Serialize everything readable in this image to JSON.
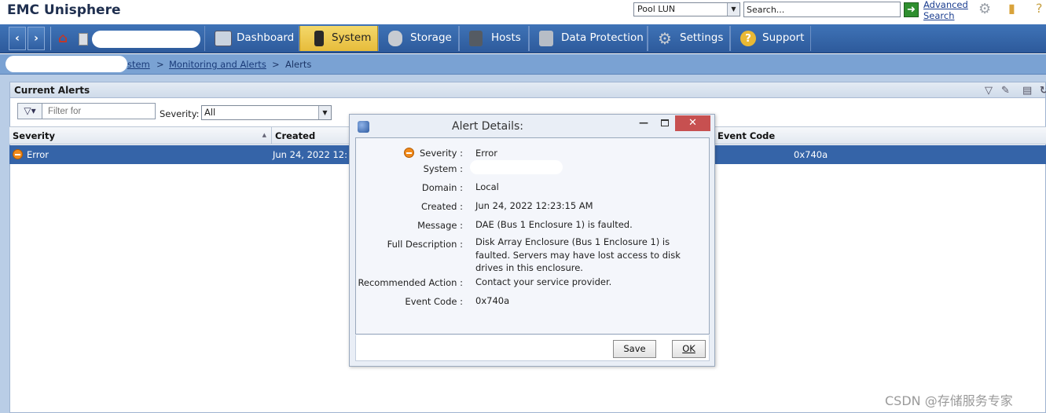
{
  "header": {
    "app_title": "EMC Unisphere",
    "scope_selected": "Pool LUN",
    "search_value": "Search...",
    "advanced_search_line1": "Advanced",
    "advanced_search_line2": "Search"
  },
  "nav": {
    "tabs": [
      {
        "label": "Dashboard",
        "icon": "dashboard-icon",
        "active": false
      },
      {
        "label": "System",
        "icon": "system-icon",
        "active": true
      },
      {
        "label": "Storage",
        "icon": "storage-icon",
        "active": false
      },
      {
        "label": "Hosts",
        "icon": "hosts-icon",
        "active": false
      },
      {
        "label": "Data Protection",
        "icon": "data-protection-icon",
        "active": false
      },
      {
        "label": "Settings",
        "icon": "settings-icon",
        "active": false
      },
      {
        "label": "Support",
        "icon": "support-icon",
        "active": false
      }
    ]
  },
  "breadcrumb": {
    "part_system": "stem",
    "sep": ">",
    "monitoring": "Monitoring and Alerts",
    "current": "Alerts"
  },
  "panel": {
    "title": "Current Alerts",
    "filter_placeholder": "Filter for",
    "severity_label": "Severity:",
    "severity_selected": "All"
  },
  "grid": {
    "columns": [
      "Severity",
      "Created",
      "Event Code"
    ],
    "rows": [
      {
        "severity": "Error",
        "created": "Jun 24, 2022 12:",
        "event_code": "0x740a"
      }
    ]
  },
  "dialog": {
    "title": "Alert Details:",
    "close": "✕",
    "fields": {
      "severity_label": "Severity :",
      "severity_value": "Error",
      "system_label": "System :",
      "domain_label": "Domain :",
      "domain_value": "Local",
      "created_label": "Created :",
      "created_value": "Jun 24, 2022 12:23:15 AM",
      "message_label": "Message :",
      "message_value": "DAE (Bus 1 Enclosure 1) is faulted.",
      "full_desc_label": "Full Description :",
      "full_desc_line1": "Disk Array Enclosure (Bus 1 Enclosure 1) is",
      "full_desc_line2": "faulted. Servers may have lost access to disk",
      "full_desc_line3": "drives in this enclosure.",
      "action_label": "Recommended Action :",
      "action_value": "Contact your service provider.",
      "event_code_label": "Event Code :",
      "event_code_value": "0x740a"
    },
    "save_label": "Save",
    "ok_label": "OK"
  },
  "watermark": "CSDN @存储服务专家",
  "colors": {
    "nav_blue": "#2d5a9b",
    "active_tab": "#e7bc3b",
    "selected_row": "#3564a8",
    "close_red": "#c75050"
  }
}
